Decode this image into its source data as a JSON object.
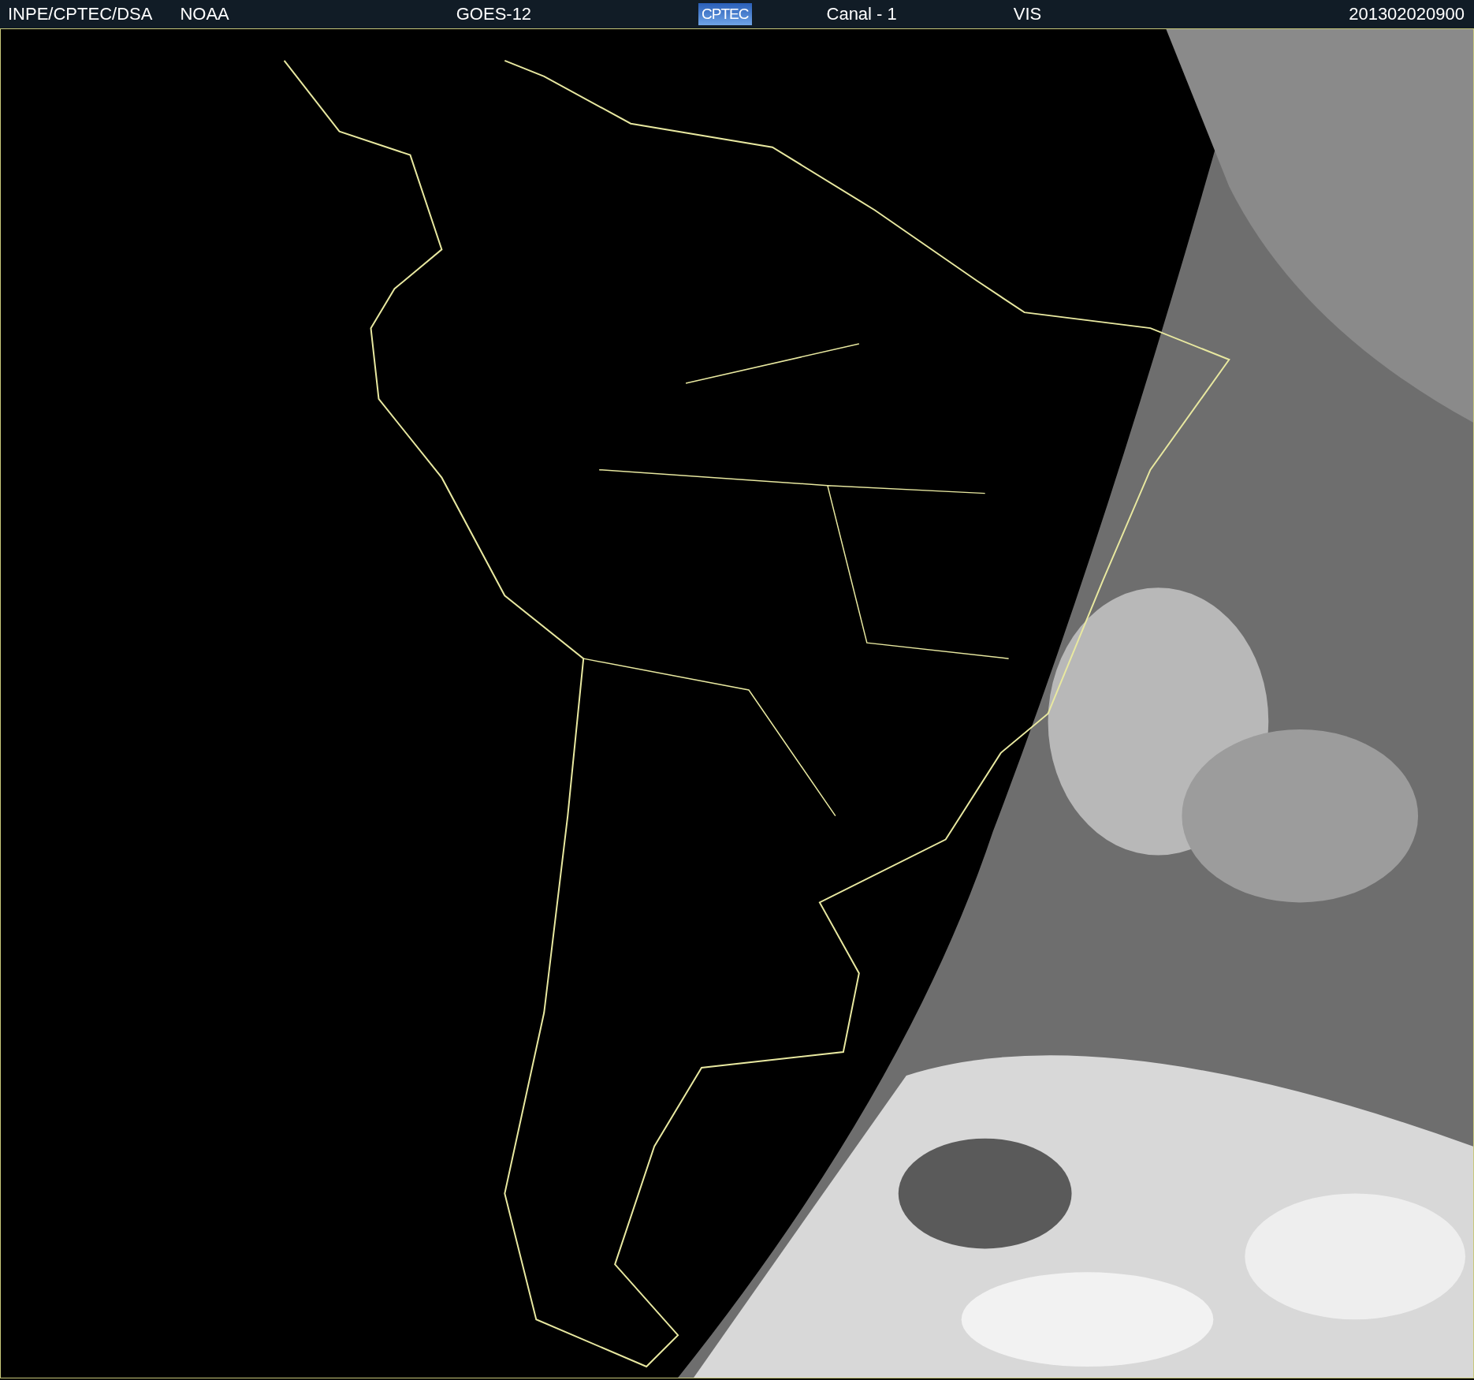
{
  "header": {
    "items": [
      {
        "kind": "text",
        "text": "INPE/CPTEC/DSA"
      },
      {
        "kind": "text",
        "text": "NOAA"
      },
      {
        "kind": "text",
        "text": "GOES-12"
      },
      {
        "kind": "logo",
        "text": "CPTEC"
      },
      {
        "kind": "text",
        "text": "Canal - 1"
      },
      {
        "kind": "text",
        "text": "VIS"
      },
      {
        "kind": "text",
        "text": "201302020900"
      }
    ]
  }
}
